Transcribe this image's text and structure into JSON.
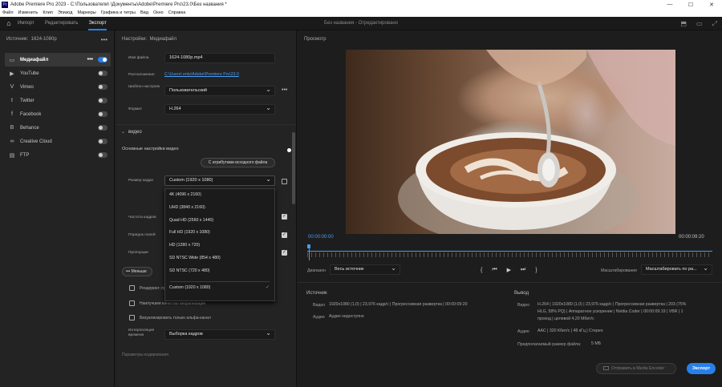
{
  "titlebar": {
    "app_icon": "Pr",
    "title": "Adobe Premiere Pro 2023 - C:\\Пользователи\\             \\Документы\\Adobe\\Premiere Pro\\23.0\\Без названия *",
    "minimize": "—",
    "maximize": "☐",
    "close": "✕"
  },
  "menu": [
    "Файл",
    "Изменить",
    "Клип",
    "Эпизод",
    "Маркеры",
    "Графика и титры",
    "Вид",
    "Окно",
    "Справка"
  ],
  "workspace": {
    "home_icon": "home-icon",
    "home_glyph": "⌂",
    "tabs": [
      "Импорт",
      "Редактировать",
      "Экспорт"
    ],
    "active_tab": 2,
    "doc_title": "Без названия - Отредактировано",
    "right_icons": [
      "⬒",
      "▭",
      "⤢"
    ]
  },
  "left": {
    "source_label": "Источник:",
    "source_value": "1624-1080p",
    "more": "•••",
    "destinations": [
      {
        "label": "Медиафайл",
        "icon": "▭",
        "on": true,
        "active": true
      },
      {
        "label": "YouTube",
        "icon": "▶",
        "on": false
      },
      {
        "label": "Vimeo",
        "icon": "V",
        "on": false
      },
      {
        "label": "Twitter",
        "icon": "t",
        "on": false
      },
      {
        "label": "Facebook",
        "icon": "f",
        "on": false
      },
      {
        "label": "Behance",
        "icon": "B",
        "on": false
      },
      {
        "label": "Creative Cloud",
        "icon": "∞",
        "on": false
      },
      {
        "label": "FTP",
        "icon": "▤",
        "on": false
      }
    ]
  },
  "settings": {
    "header": "Настройки:",
    "header_value": "Медиафайл",
    "file_name_label": "Имя файла",
    "file_name": "1624-1080p.mp4",
    "location_label": "Расположение",
    "location": "C:\\Users\\       ents\\Adobe\\Premiere Pro\\23.0",
    "preset_label": "Шаблон настроек",
    "preset": "Пользовательский",
    "preset_more": "•••",
    "format_label": "Формат",
    "format": "H.264",
    "video_section": "видео",
    "video_basic": "Основные настройки видео",
    "match_source": "С атрибутами исходного файла",
    "frame_size_label": "Размер кадра",
    "frame_size": "Custom (1920 x 1080)",
    "frame_rate_label": "Частота кадров",
    "field_order_label": "Порядок полей",
    "aspect_label": "Пропорции",
    "less_button": "Меньше",
    "render_alpha": "Рендеринг: пр",
    "max_quality": "Наилучшее качество визуализации",
    "render_alpha_only": "Визуализировать только альфа-канал",
    "interp_label": "Интерполяция времени",
    "interp": "Выборка кадров",
    "bottom_cut": "Параметры кодирования"
  },
  "frame_options": [
    "4K (4096 x 2160)",
    "UHD (3840 x 2160)",
    "Quad HD (2560 x 1440)",
    "Full HD (1920 x 1080)",
    "HD (1280 x 720)",
    "SD NTSC Wide (854 x 480)",
    "SD NTSC (720 x 480)",
    "Custom (1920 x 1080)"
  ],
  "preview": {
    "header": "Просмотр",
    "timecode_current": "00:00:00:00",
    "timecode_end": "00:00:09:20",
    "range_label": "Диапазон",
    "range_value": "Весь источник",
    "scale_label": "Масштабирование",
    "scale_value": "Масштабировать по ра...",
    "controls": [
      "{",
      "⏮",
      "▶",
      "⏭",
      "}"
    ]
  },
  "source_info": {
    "title": "Источник",
    "video_key": "Видео",
    "video_val": "1920x1080 (1,0)  |  23,976 кадр/с  |  Прогрессивная развертка  |  00:00:09:20",
    "audio_key": "Аудио",
    "audio_val": "Аудио недоступно"
  },
  "output_info": {
    "title": "Вывод",
    "video_key": "Видео",
    "video_val_1": "H.264  |  1920x1080 (1,0)  |  23,976 кадр/с  |  Прогрессивная развертка  |  203 (75%",
    "video_val_2": "HLG, 58% PQ)  |  Аппаратное ускорение  |  Nvidia Coder  |  00:00:09:19  |  VBR  |  1",
    "video_val_3": "проход  |  целевой 4,20 Мбит/с",
    "audio_key": "Аудио",
    "audio_val": "AAC  |  320 Кбит/с  |  48 кГц  |  Стерео",
    "size_key": "Предполагаемый размер файла:",
    "size_val": "5 МБ"
  },
  "footer": {
    "media_encoder": "Отправить в Media Encoder",
    "export": "Экспорт"
  },
  "colors": {
    "accent": "#2680eb",
    "link": "#4b9cf5",
    "panel": "#232323",
    "background": "#1d1d1d"
  }
}
